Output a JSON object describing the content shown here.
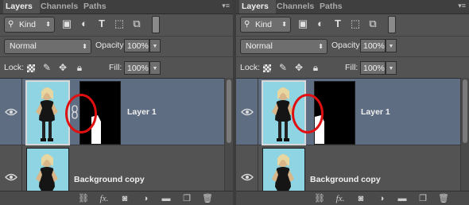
{
  "panels": [
    {
      "tabs": [
        {
          "label": "Layers",
          "active": true
        },
        {
          "label": "Channels",
          "active": false
        },
        {
          "label": "Paths",
          "active": false
        }
      ],
      "filter": {
        "kind_label": "Kind",
        "icons": [
          "image-filter-icon",
          "adjustment-filter-icon",
          "type-filter-icon",
          "shape-filter-icon",
          "smart-object-filter-icon",
          "filter-toggle-icon"
        ]
      },
      "blend_mode": "Normal",
      "opacity_label": "Opacity:",
      "opacity_value": "100%",
      "lock_label": "Lock:",
      "fill_label": "Fill:",
      "fill_value": "100%",
      "layers": [
        {
          "name": "Layer 1",
          "selected": true,
          "has_mask": true,
          "mask_linked": true,
          "visible": true
        },
        {
          "name": "Background copy",
          "selected": false,
          "has_mask": false,
          "visible": true
        }
      ],
      "annotation": {
        "shape": "red-circle",
        "color": "#e01010",
        "highlights": "layer-mask-link-icon"
      }
    },
    {
      "tabs": [
        {
          "label": "Layers",
          "active": true
        },
        {
          "label": "Channels",
          "active": false
        },
        {
          "label": "Paths",
          "active": false
        }
      ],
      "filter": {
        "kind_label": "Kind",
        "icons": [
          "image-filter-icon",
          "adjustment-filter-icon",
          "type-filter-icon",
          "shape-filter-icon",
          "smart-object-filter-icon",
          "filter-toggle-icon"
        ]
      },
      "blend_mode": "Normal",
      "opacity_label": "Opacity:",
      "opacity_value": "100%",
      "lock_label": "Lock:",
      "fill_label": "Fill:",
      "fill_value": "100%",
      "layers": [
        {
          "name": "Layer 1",
          "selected": true,
          "has_mask": true,
          "mask_linked": false,
          "visible": true
        },
        {
          "name": "Background copy",
          "selected": false,
          "has_mask": false,
          "visible": true
        }
      ],
      "annotation": {
        "shape": "red-circle",
        "color": "#e01010",
        "highlights": "empty-link-slot"
      }
    }
  ],
  "footer_icons": [
    "link-layers-icon",
    "fx-icon",
    "add-mask-icon",
    "adjustment-layer-icon",
    "new-group-icon",
    "new-layer-icon",
    "trash-icon"
  ],
  "colors": {
    "panel_bg": "#535353",
    "selected_layer_bg": "#5e6d82",
    "tab_bar_bg": "#3f3f3f",
    "annotation_red": "#e01010",
    "thumb_teal": "#8ed4e2"
  }
}
